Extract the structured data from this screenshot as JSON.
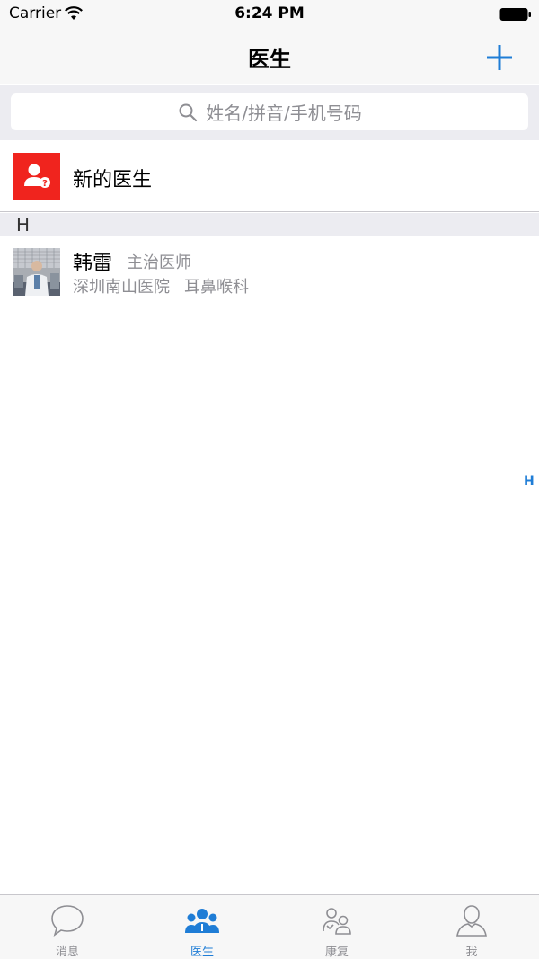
{
  "status_bar": {
    "carrier": "Carrier",
    "time": "6:24 PM"
  },
  "nav": {
    "title": "医生",
    "add_icon": "plus-icon"
  },
  "search": {
    "placeholder": "姓名/拼音/手机号码"
  },
  "new_doctors": {
    "label": "新的医生",
    "icon": "new-doctor-icon"
  },
  "sections": [
    {
      "letter": "H",
      "doctors": [
        {
          "name": "韩雷",
          "title": "主治医师",
          "hospital": "深圳南山医院",
          "department": "耳鼻喉科"
        }
      ]
    }
  ],
  "index": [
    "H"
  ],
  "tabs": [
    {
      "label": "消息",
      "icon": "chat-bubble-icon",
      "active": false
    },
    {
      "label": "医生",
      "icon": "doctors-group-icon",
      "active": true
    },
    {
      "label": "康复",
      "icon": "rehab-icon",
      "active": false
    },
    {
      "label": "我",
      "icon": "person-icon",
      "active": false
    }
  ],
  "colors": {
    "accent": "#1f7dd6",
    "new_doctor_bg": "#f0241e",
    "bar_bg": "#f7f7f7",
    "section_bg": "#ececf1"
  }
}
